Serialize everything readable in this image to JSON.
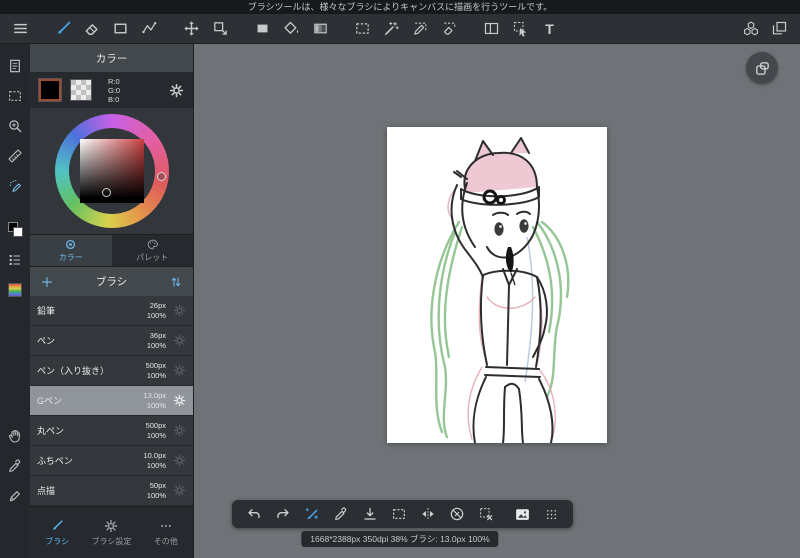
{
  "tooltip": "ブラシツールは、様々なブラシによりキャンバスに描画を行うツールです。",
  "toolbar": {
    "text_tool_label": "T",
    "selected_tool": "brush",
    "icons": [
      "menu",
      "brush",
      "eraser",
      "rectangle",
      "polyline",
      "move",
      "transform",
      "fill-rect",
      "paint-bucket",
      "gradient",
      "select-rectangle",
      "magic-wand",
      "select-pen",
      "select-eraser",
      "split-view",
      "select-move",
      "text",
      "materials",
      "layers"
    ]
  },
  "left_strip_icons": [
    "new-document",
    "select",
    "zoom",
    "ruler",
    "airbrush",
    "foreground-background-color",
    "color-set",
    "gradient-chip",
    "hand",
    "eyedropper",
    "pen"
  ],
  "color_panel": {
    "title": "カラー",
    "rgb_lines": [
      "R:0",
      "G:0",
      "B:0"
    ],
    "tabs": [
      {
        "label": "カラー",
        "selected": true
      },
      {
        "label": "パレット",
        "selected": false
      }
    ]
  },
  "brush_panel": {
    "title": "ブラシ",
    "brushes": [
      {
        "name": "鉛筆",
        "size": "26px",
        "opacity": "100%",
        "selected": false
      },
      {
        "name": "ペン",
        "size": "36px",
        "opacity": "100%",
        "selected": false
      },
      {
        "name": "ペン（入り抜き）",
        "size": "500px",
        "opacity": "100%",
        "selected": false
      },
      {
        "name": "Gペン",
        "size": "13.0px",
        "opacity": "100%",
        "selected": true
      },
      {
        "name": "丸ペン",
        "size": "500px",
        "opacity": "100%",
        "selected": false
      },
      {
        "name": "ふちペン",
        "size": "10.0px",
        "opacity": "100%",
        "selected": false
      },
      {
        "name": "点描",
        "size": "50px",
        "opacity": "100%",
        "selected": false
      }
    ],
    "tabs": [
      {
        "label": "ブラシ",
        "selected": true
      },
      {
        "label": "ブラシ設定",
        "selected": false
      },
      {
        "label": "その他",
        "selected": false
      }
    ]
  },
  "bottom_toolbar_icons": [
    "undo",
    "redo",
    "brush",
    "eyedropper",
    "save",
    "select-rectangle",
    "flip-horizontal",
    "draw-disabled",
    "deselect",
    "image",
    "drag-handle"
  ],
  "status_bar": {
    "text": "1668*2388px 350dpi 38% ブラシ: 13.0px 100%"
  },
  "colors": {
    "accent_blue": "#4aa3e8",
    "canvas_background": "#6f7377",
    "panel_dark": "#2e3236",
    "selected_brush_row": "#8f959a",
    "current_color": "#000000",
    "rgb": {
      "r": 0,
      "g": 0,
      "b": 0
    }
  }
}
